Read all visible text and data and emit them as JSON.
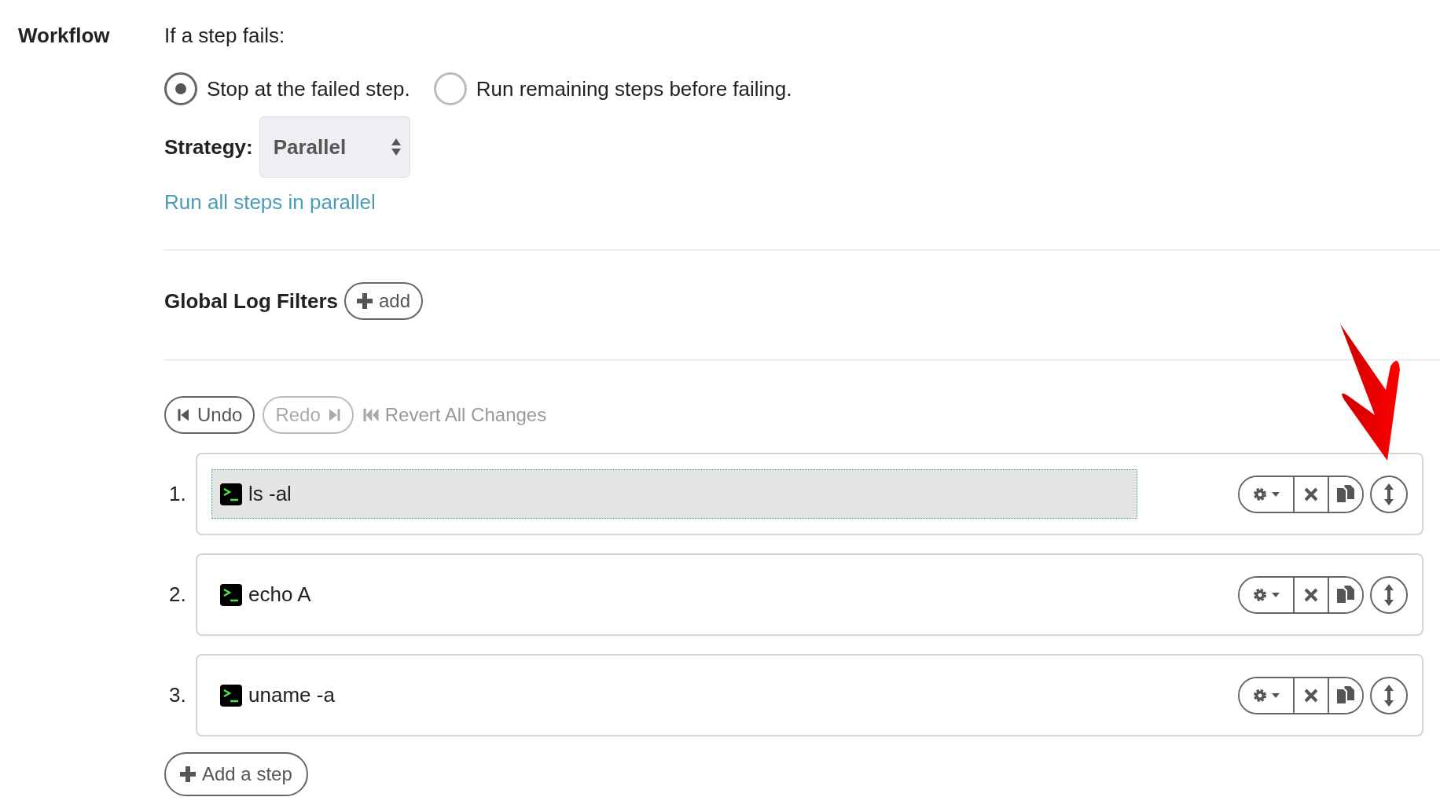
{
  "section_label": "Workflow",
  "failure": {
    "prompt": "If a step fails:",
    "options": [
      {
        "label": "Stop at the failed step.",
        "selected": true
      },
      {
        "label": "Run remaining steps before failing.",
        "selected": false
      }
    ]
  },
  "strategy": {
    "label": "Strategy:",
    "value": "Parallel",
    "description": "Run all steps in parallel"
  },
  "log_filters": {
    "title": "Global Log Filters",
    "add_button": "add"
  },
  "history": [
    {
      "label": "Undo",
      "kind": "undo",
      "disabled": false
    },
    {
      "label": "Redo",
      "kind": "redo",
      "disabled": true
    },
    {
      "label": "Revert All Changes",
      "kind": "revert",
      "disabled": true
    }
  ],
  "steps": [
    {
      "number": "1.",
      "command": "ls -al",
      "selected": true
    },
    {
      "number": "2.",
      "command": "echo A",
      "selected": false
    },
    {
      "number": "3.",
      "command": "uname -a",
      "selected": false
    }
  ],
  "add_step_button": "Add a step"
}
